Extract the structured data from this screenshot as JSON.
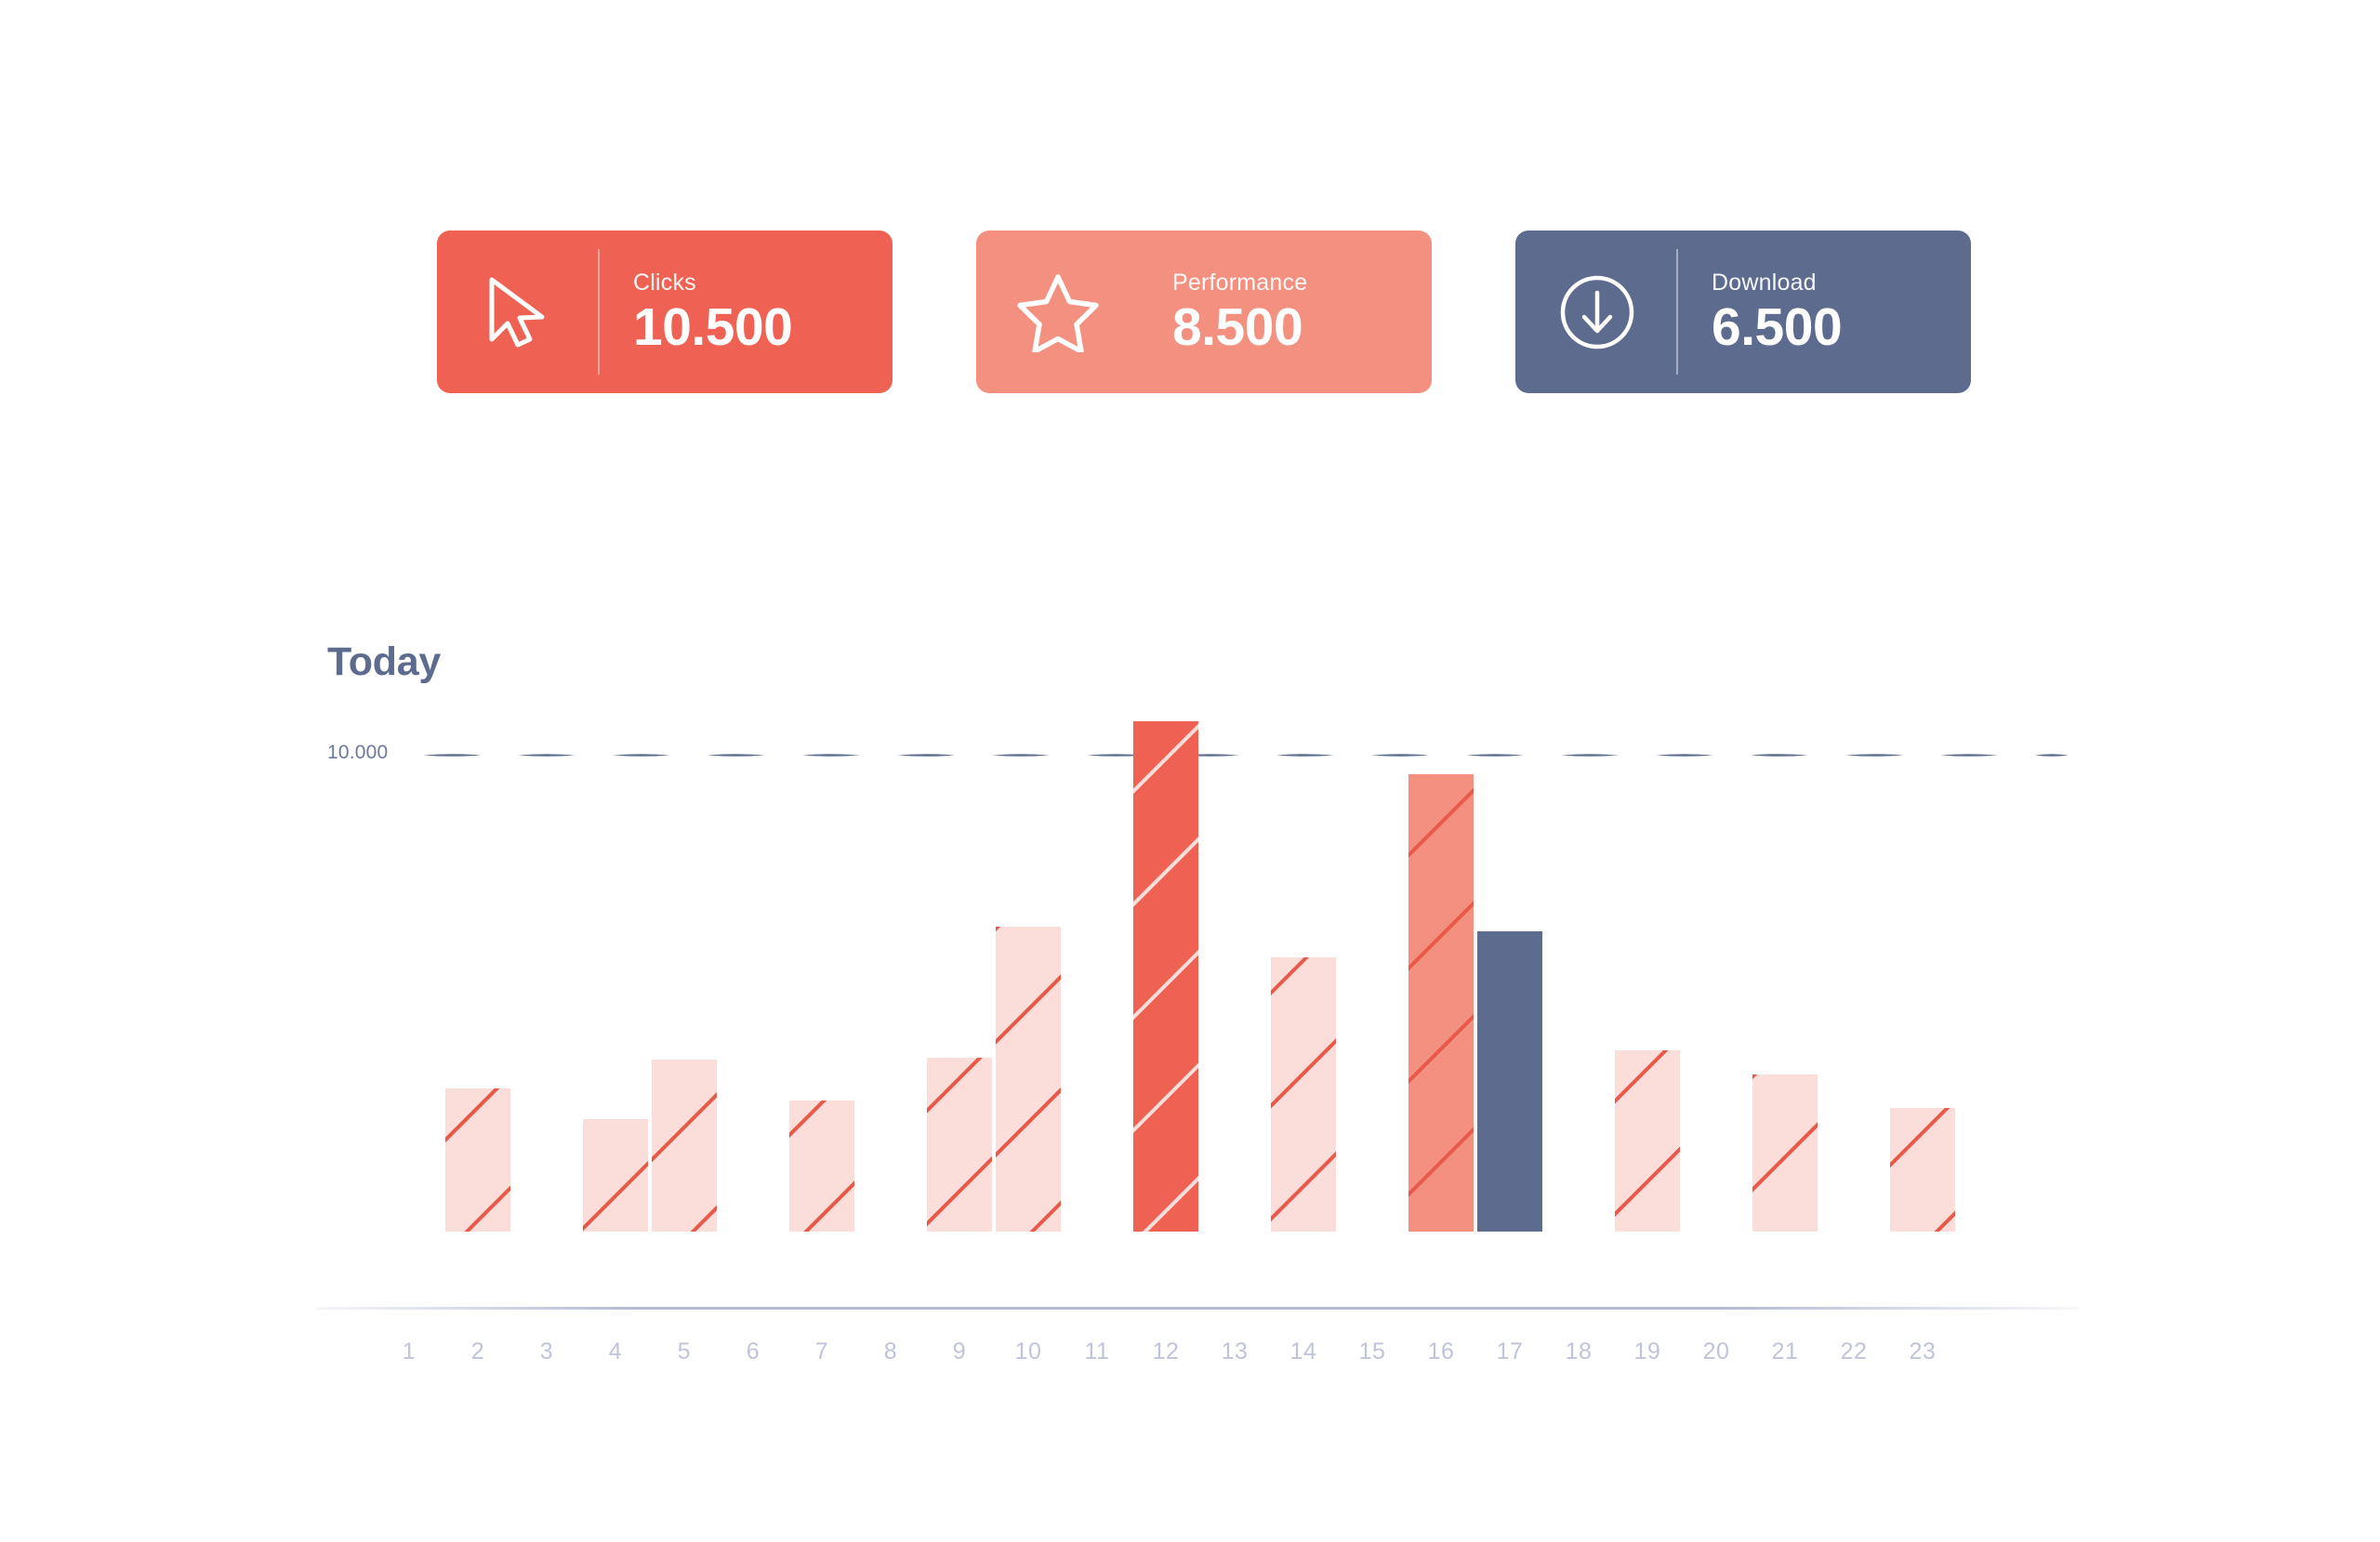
{
  "cards": [
    {
      "id": "clicks",
      "label": "Clicks",
      "value": "10.500",
      "icon": "cursor-pointer-icon",
      "bg": "#EF6152",
      "divider": true
    },
    {
      "id": "performance",
      "label": "Performance",
      "value": "8.500",
      "icon": "star-outline-icon",
      "bg": "#F4907F",
      "divider": false
    },
    {
      "id": "download",
      "label": "Download",
      "value": "6.500",
      "icon": "download-circle-icon",
      "bg": "#5D6C8E",
      "divider": true
    }
  ],
  "chart": {
    "title": "Today",
    "threshold_label": "10.000",
    "threshold_color": "#5D6C8E",
    "axis_color": "#A8AFCB",
    "tick_color": "#BFC4DA"
  },
  "chart_data": {
    "type": "bar",
    "title": "Today",
    "xlabel": "",
    "ylabel": "",
    "ylim": [
      0,
      11500
    ],
    "grid": false,
    "legend": "none",
    "annotations": [
      {
        "type": "threshold-line",
        "value": 10000,
        "label": "10.000",
        "style": "dashed",
        "color": "#5D6C8E"
      }
    ],
    "categories": [
      "1",
      "2",
      "3",
      "4",
      "5",
      "6",
      "7",
      "8",
      "9",
      "10",
      "11",
      "12",
      "13",
      "14",
      "15",
      "16",
      "17",
      "18",
      "19",
      "20",
      "21",
      "22",
      "23"
    ],
    "tick_labels": [
      "1",
      "2",
      "3",
      "4",
      "5",
      "6",
      "7",
      "8",
      "9",
      "10",
      "11",
      "12",
      "13",
      "14",
      "15",
      "16",
      "17",
      "18",
      "19",
      "20",
      "21",
      "22",
      "23"
    ],
    "bars": [
      {
        "x": "2",
        "value": 3000,
        "style": "light"
      },
      {
        "x": "4",
        "value": 2350,
        "style": "light"
      },
      {
        "x": "5",
        "value": 3600,
        "style": "light"
      },
      {
        "x": "7",
        "value": 2750,
        "style": "light"
      },
      {
        "x": "9",
        "value": 3650,
        "style": "light"
      },
      {
        "x": "10",
        "value": 6400,
        "style": "light"
      },
      {
        "x": "12",
        "value": 10700,
        "style": "highlight"
      },
      {
        "x": "14",
        "value": 5750,
        "style": "light"
      },
      {
        "x": "16",
        "value": 9600,
        "style": "medium"
      },
      {
        "x": "17",
        "value": 6300,
        "style": "solid-blue"
      },
      {
        "x": "19",
        "value": 3800,
        "style": "light"
      },
      {
        "x": "21",
        "value": 3300,
        "style": "light"
      },
      {
        "x": "23",
        "value": 2600,
        "style": "light"
      }
    ],
    "bar_styles": {
      "light": {
        "fill": "#FBDEDA",
        "stripe": "#E8594A"
      },
      "medium": {
        "fill": "#F4907F",
        "stripe": "#E8594A"
      },
      "highlight": {
        "fill": "#EF6152",
        "stripe": "#FBDEDA"
      },
      "solid-blue": {
        "fill": "#5D6C8E",
        "stripe": "none"
      }
    }
  }
}
